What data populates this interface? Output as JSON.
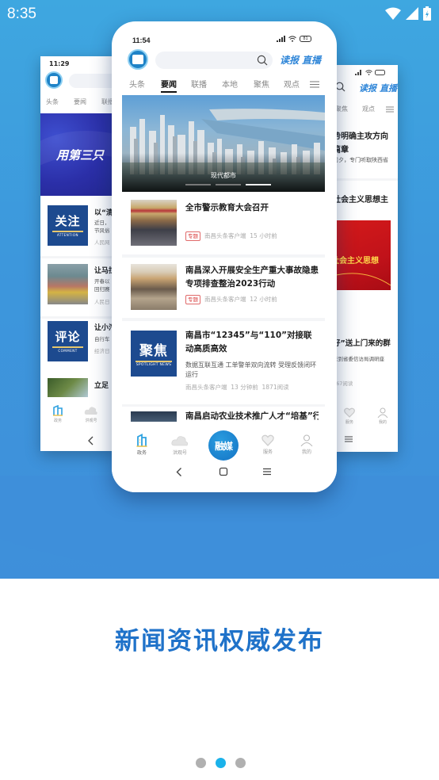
{
  "status_bar": {
    "time": "8:35",
    "icons": [
      "wifi-icon",
      "signal-icon",
      "battery-charging-icon"
    ]
  },
  "theme": {
    "background_blue": "#3d97dc",
    "accent_blue": "#1f72c9",
    "pager_active": "#1bb2ea",
    "pager_inactive": "#b0b0b0"
  },
  "left_phone": {
    "time": "11:29",
    "tabs": [
      "头条",
      "要闻",
      "联播"
    ],
    "banner_text": "用第三只",
    "items": [
      {
        "thumb_card": "关注",
        "thumb_sub": "ATTENTION",
        "title": "以“清",
        "summary": [
          "近日，",
          "节风俗"
        ],
        "meta": "人民网"
      },
      {
        "thumb_card": "",
        "thumb_sub": "",
        "title": "让马拉",
        "summary": [
          "开春以",
          "回归赛"
        ],
        "meta": "人民日"
      },
      {
        "thumb_card": "评论",
        "thumb_sub": "COMMENT",
        "title": "让小汽",
        "summary": [
          "自行车"
        ],
        "meta": "经济日"
      },
      {
        "thumb_card": "",
        "thumb_sub": "",
        "title": "立足",
        "summary": [],
        "meta": ""
      }
    ],
    "tabbar": [
      "政务",
      "洪观号"
    ]
  },
  "main_phone": {
    "time": "11:54",
    "battery": "81",
    "header_links": [
      "读报",
      "直播"
    ],
    "search_placeholder": "",
    "tabs": [
      {
        "label": "头条",
        "active": false
      },
      {
        "label": "要闻",
        "active": true
      },
      {
        "label": "联播",
        "active": false
      },
      {
        "label": "本地",
        "active": false
      },
      {
        "label": "聚焦",
        "active": false
      },
      {
        "label": "观点",
        "active": false
      }
    ],
    "banner": {
      "caption": "现代都市",
      "slide_count": 3,
      "active_slide": 3
    },
    "news": [
      {
        "title": "全市警示教育大会召开",
        "tag": "专题",
        "source": "南昌头条客户端",
        "time": "15 小时前"
      },
      {
        "title": "南昌深入开展安全生产重大事故隐患专项排查整治2023行动",
        "tag": "专题",
        "source": "南昌头条客户端",
        "time": "12 小时前"
      },
      {
        "title": "南昌市“12345”与“110”对接联动高质高效",
        "thumb_card": "聚焦",
        "thumb_sub": "SPOTLIGHT NEWS",
        "summary": "数据互联互通 工单警单双向流转 受理反馈闭环运行",
        "source": "南昌头条客户端",
        "time": "13 分钟前",
        "reads": "1871阅读"
      },
      {
        "title": "南昌启动农业技术推广人才“培基”行"
      }
    ],
    "tabbar": [
      {
        "label": "政务",
        "icon": "building-icon",
        "active": true
      },
      {
        "label": "洪观号",
        "icon": "cloud-icon",
        "active": false
      },
      {
        "label": "融媒",
        "icon": "rongmei-center-button",
        "active": false
      },
      {
        "label": "服务",
        "icon": "heart-icon",
        "active": false
      },
      {
        "label": "我的",
        "icon": "user-icon",
        "active": false
      }
    ]
  },
  "right_phone": {
    "header_links": [
      "读报",
      "直播"
    ],
    "tabs": [
      "聚焦",
      "观点"
    ],
    "lines": [
      "势明确主攻方向",
      "篇章",
      "前夕，专门听取陕西省",
      "社会主义思想主",
      "社会主义思想",
      "好”送上门来的群",
      "来到省委信访局调研座",
      "567阅读"
    ],
    "tabbar": [
      "服务",
      "我的"
    ]
  },
  "headline": "新闻资讯权威发布",
  "pager": {
    "count": 3,
    "active_index": 1
  }
}
